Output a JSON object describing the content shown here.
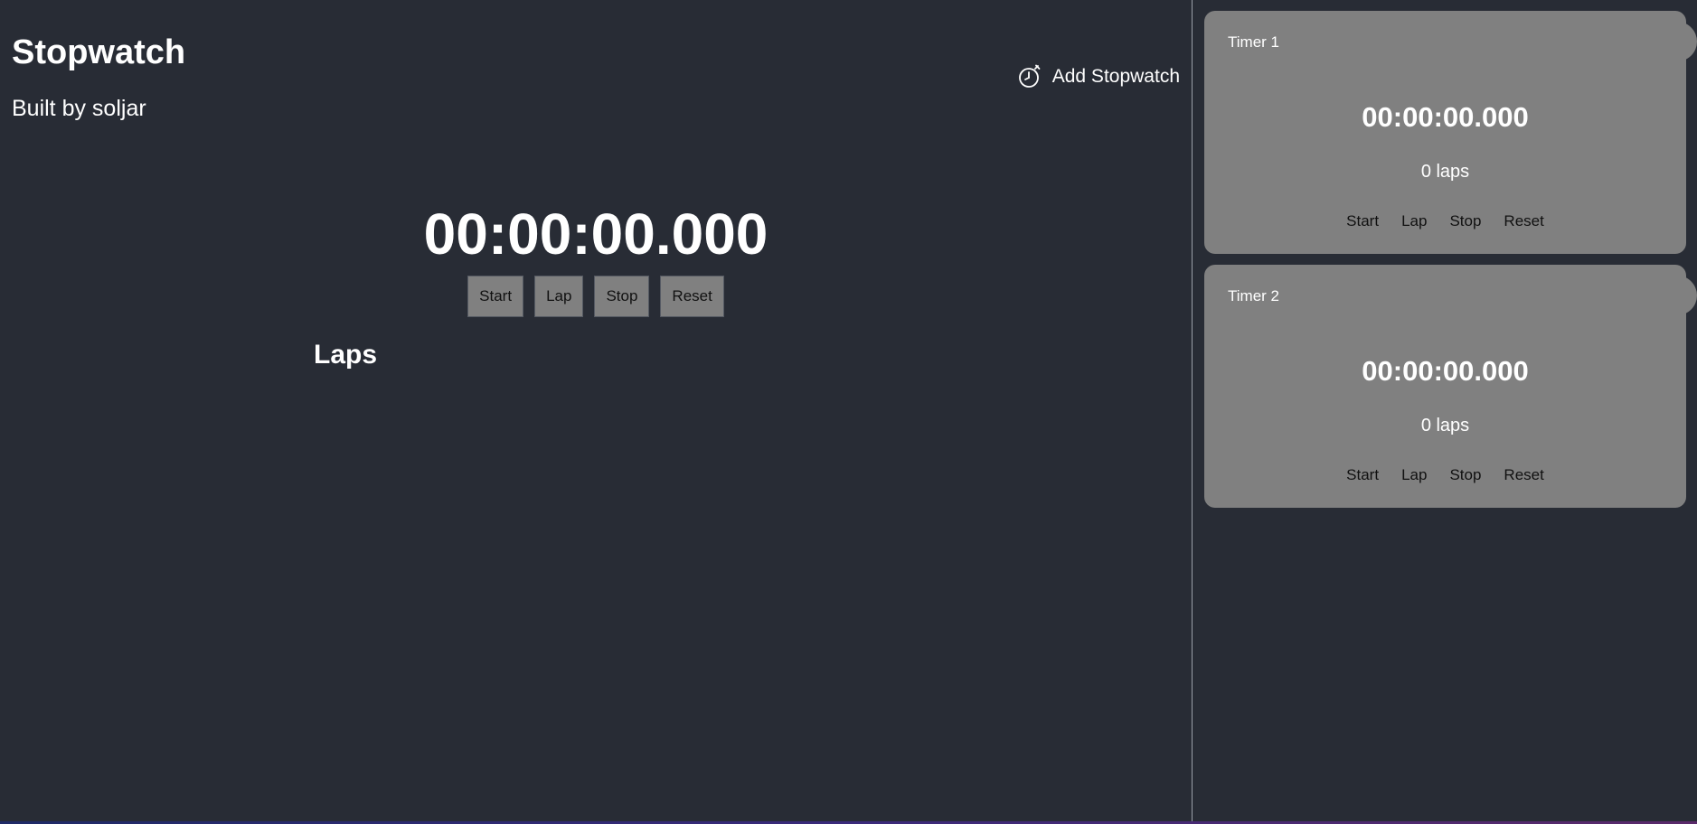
{
  "header": {
    "title": "Stopwatch",
    "subtitle": "Built by soljar",
    "add_button": {
      "label": "Add Stopwatch",
      "icon": "stopwatch-icon"
    }
  },
  "main": {
    "time": "00:00:00.000",
    "controls": {
      "start": "Start",
      "lap": "Lap",
      "stop": "Stop",
      "reset": "Reset"
    },
    "laps_heading": "Laps"
  },
  "timers": [
    {
      "title": "Timer 1",
      "time": "00:00:00.000",
      "laps": "0 laps",
      "controls": {
        "start": "Start",
        "lap": "Lap",
        "stop": "Stop",
        "reset": "Reset"
      }
    },
    {
      "title": "Timer 2",
      "time": "00:00:00.000",
      "laps": "0 laps",
      "controls": {
        "start": "Start",
        "lap": "Lap",
        "stop": "Stop",
        "reset": "Reset"
      }
    }
  ],
  "colors": {
    "background": "#282c35",
    "card": "#808080",
    "button": "#808080",
    "text": "#ffffff",
    "button_text": "#111111"
  }
}
